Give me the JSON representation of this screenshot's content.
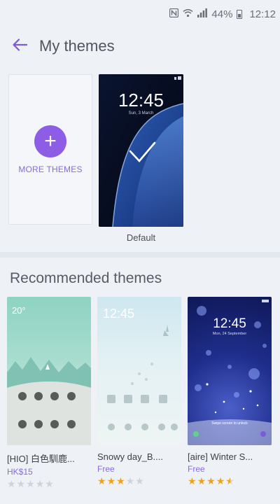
{
  "status_bar": {
    "nfc_icon": "nfc-icon",
    "wifi_icon": "wifi-icon",
    "signal_icon": "signal-icon",
    "battery_percent": "44%",
    "time": "12:12"
  },
  "app_bar": {
    "back_icon": "arrow-left-icon",
    "title": "My themes"
  },
  "my_themes": {
    "more_button_label": "MORE THEMES",
    "plus_icon": "+",
    "default_theme": {
      "label": "Default",
      "preview_time": "12:45",
      "preview_date": "Sun, 3 March"
    }
  },
  "recommended": {
    "title": "Recommended themes",
    "items": [
      {
        "name": "[HIO] 白色馴鹿...",
        "price": "HK$15",
        "rating": 0,
        "preview_time": "20°"
      },
      {
        "name": "Snowy day_B....",
        "price": "Free",
        "rating": 3,
        "preview_time": "12:45"
      },
      {
        "name": "[aire] Winter S...",
        "price": "Free",
        "rating": 4.5,
        "preview_time": "12:45",
        "preview_date": "Mon, 24 September",
        "preview_hint": "Swipe screen to unlock"
      }
    ]
  },
  "colors": {
    "accent": "#8e5de6",
    "star": "#f0a21a"
  }
}
